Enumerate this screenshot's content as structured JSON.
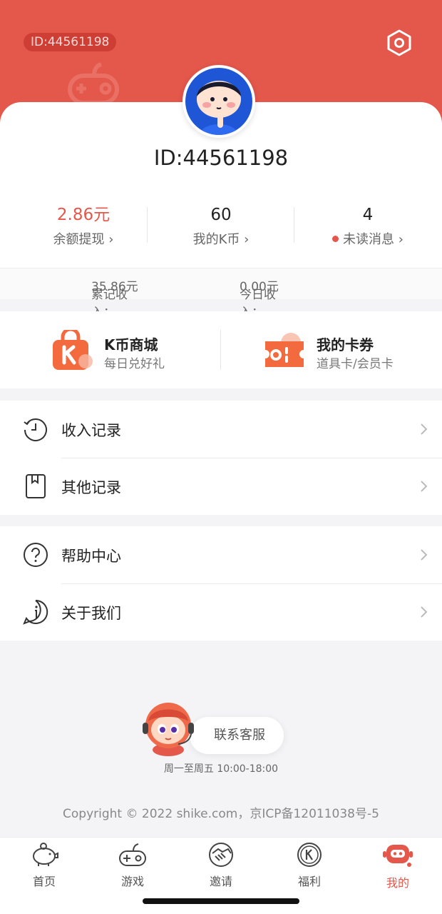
{
  "header": {
    "id_pill": "ID:44561198",
    "settings_icon": "hexagon-settings-icon"
  },
  "profile": {
    "user_id": "ID:44561198"
  },
  "stats": [
    {
      "value": "2.86元",
      "label": "余额提现"
    },
    {
      "value": "60",
      "label": "我的K币"
    },
    {
      "value": "4",
      "label": "未读消息"
    }
  ],
  "income": {
    "total_label": "累记收入：",
    "total_value": "35.86元",
    "today_label": "今日收入：",
    "today_value": "0.00元"
  },
  "mall": {
    "kcoin": {
      "title": "K币商城",
      "subtitle": "每日兑好礼"
    },
    "cards": {
      "title": "我的卡券",
      "subtitle": "道具卡/会员卡"
    }
  },
  "menu": {
    "group1": [
      "收入记录",
      "其他记录"
    ],
    "group2": [
      "帮助中心",
      "关于我们"
    ]
  },
  "support": {
    "button": "联系客服",
    "hours": "周一至周五 10:00-18:00"
  },
  "footer": {
    "copyright": "Copyright © 2022 shike.com，京ICP备12011038号-5"
  },
  "tabbar": {
    "active": "我的",
    "tabs": [
      "首页",
      "游戏",
      "邀请",
      "福利",
      "我的"
    ]
  },
  "colors": {
    "brand": "#e4574b",
    "orange": "#f26a3d"
  }
}
